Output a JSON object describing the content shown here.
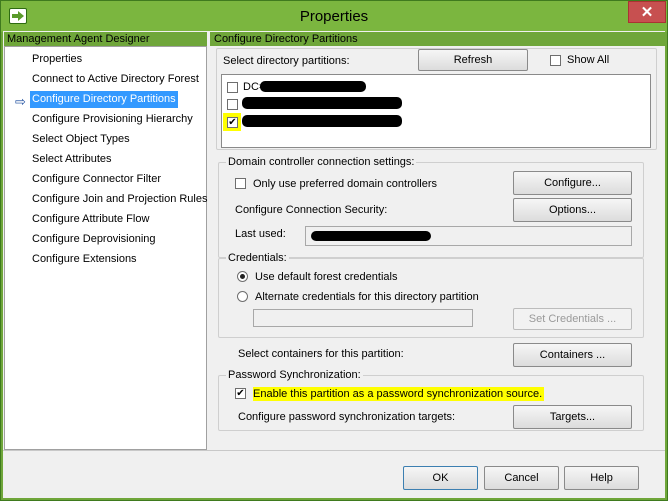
{
  "window": {
    "title": "Properties",
    "close_symbol": "✕"
  },
  "left": {
    "header": "Management Agent Designer",
    "items": [
      "Properties",
      "Connect to Active Directory Forest",
      "Configure Directory Partitions",
      "Configure Provisioning Hierarchy",
      "Select Object Types",
      "Select Attributes",
      "Configure Connector Filter",
      "Configure Join and Projection Rules",
      "Configure Attribute Flow",
      "Configure Deprovisioning",
      "Configure Extensions"
    ],
    "selected_index": 2,
    "selected_arrow": "⇨"
  },
  "right": {
    "header": "Configure Directory Partitions",
    "select_partitions_label": "Select directory partitions:",
    "refresh_label": "Refresh",
    "show_all_label": "Show All",
    "partitions": [
      {
        "label": "DC=",
        "checked": false
      },
      {
        "label": "",
        "checked": false
      },
      {
        "label": "",
        "checked": true
      }
    ],
    "dc_group": {
      "title": "Domain controller connection settings:",
      "only_preferred_label": "Only use preferred domain controllers",
      "configure_label": "Configure...",
      "security_label": "Configure Connection Security:",
      "options_label": "Options...",
      "last_used_label": "Last used:"
    },
    "credentials_group": {
      "title": "Credentials:",
      "default_label": "Use default forest credentials",
      "alternate_label": "Alternate credentials for this directory partition",
      "set_credentials_label": "Set Credentials ..."
    },
    "containers_label": "Select containers for this partition:",
    "containers_button": "Containers ...",
    "password_group": {
      "title": "Password Synchronization:",
      "enable_label": "Enable this partition as a password synchronization source.",
      "targets_label": "Configure password synchronization targets:",
      "targets_button": "Targets..."
    }
  },
  "footer": {
    "ok": "OK",
    "cancel": "Cancel",
    "help": "Help"
  },
  "colors": {
    "title_green": "#7bb63f",
    "header_green": "#6fa63a",
    "selection_blue": "#3399ff",
    "highlight_yellow": "#ffff00"
  }
}
